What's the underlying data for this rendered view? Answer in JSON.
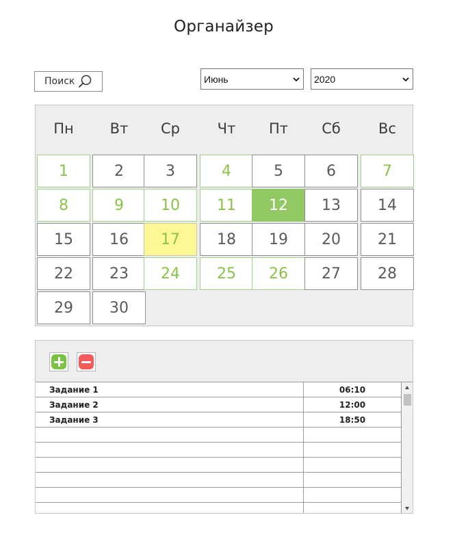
{
  "title": "Органайзер",
  "search": {
    "label": "Поиск"
  },
  "month_select": {
    "value": "Июнь"
  },
  "year_select": {
    "value": "2020"
  },
  "calendar": {
    "weekdays": [
      "Пн",
      "Вт",
      "Ср",
      "Чт",
      "Пт",
      "Сб",
      "Вс"
    ],
    "days_in_month": 30,
    "first_weekday_index": 0,
    "green_days": [
      1,
      4,
      7,
      8,
      9,
      10,
      11,
      24,
      25,
      26
    ],
    "selected_day": 12,
    "today_day": 17,
    "colors": {
      "green_text": "#8bc34a",
      "green_border": "#9fd18a",
      "selected_bg": "#93c965",
      "today_bg": "#fdf796",
      "normal_text": "#5a5a5a"
    }
  },
  "tasks": {
    "add_icon": "plus-icon",
    "remove_icon": "minus-icon",
    "rows": [
      {
        "name": "Задание 1",
        "time": "06:10"
      },
      {
        "name": "Задание 2",
        "time": "12:00"
      },
      {
        "name": "Задание 3",
        "time": "18:50"
      },
      {
        "name": "",
        "time": ""
      },
      {
        "name": "",
        "time": ""
      },
      {
        "name": "",
        "time": ""
      },
      {
        "name": "",
        "time": ""
      },
      {
        "name": "",
        "time": ""
      },
      {
        "name": "",
        "time": ""
      }
    ]
  }
}
